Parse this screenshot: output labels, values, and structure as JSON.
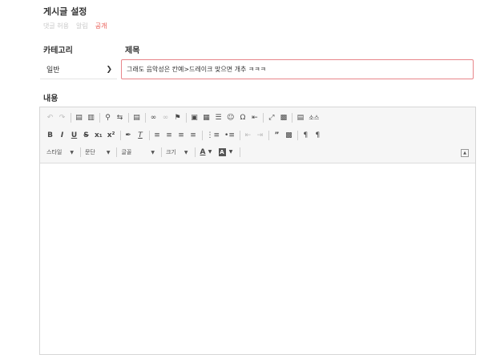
{
  "post_settings": {
    "heading": "게시글 설정",
    "options": [
      {
        "label": "댓글 허용",
        "active": false
      },
      {
        "label": "알림",
        "active": false
      },
      {
        "label": "공개",
        "active": true
      }
    ]
  },
  "category": {
    "label": "카테고리",
    "selected": "일반"
  },
  "title": {
    "label": "제목",
    "value": "그래도 음악성은 칸예>드레이크 맞으면 개추 ㅋㅋㅋ"
  },
  "content": {
    "label": "내용"
  },
  "toolbar": {
    "row1": [
      "undo-icon",
      "redo-icon",
      "|",
      "paste-icon",
      "paste-text-icon",
      "|",
      "find-icon",
      "replace-icon",
      "|",
      "template-icon",
      "|",
      "link-icon",
      "unlink-icon",
      "anchor-icon",
      "|",
      "image-icon",
      "table-icon",
      "hr-icon",
      "emoji-icon",
      "special-char-icon",
      "pagebreak-icon",
      "|",
      "maximize-icon",
      "show-blocks-icon",
      "|",
      "source-icon"
    ],
    "source_label": "소스",
    "row2": [
      "bold-icon",
      "italic-icon",
      "underline-icon",
      "strike-icon",
      "subscript-icon",
      "superscript-icon",
      "|",
      "format-icon",
      "remove-format-icon",
      "|",
      "align-left-icon",
      "align-center-icon",
      "align-right-icon",
      "justify-icon",
      "|",
      "numbered-list-icon",
      "bulleted-list-icon",
      "|",
      "outdent-icon",
      "indent-icon",
      "blockquote-icon",
      "div-icon",
      "|",
      "ltr-icon",
      "rtl-icon"
    ],
    "combos": {
      "style": "스타일",
      "paragraph": "문단",
      "font": "글꼴",
      "size": "크기"
    }
  }
}
